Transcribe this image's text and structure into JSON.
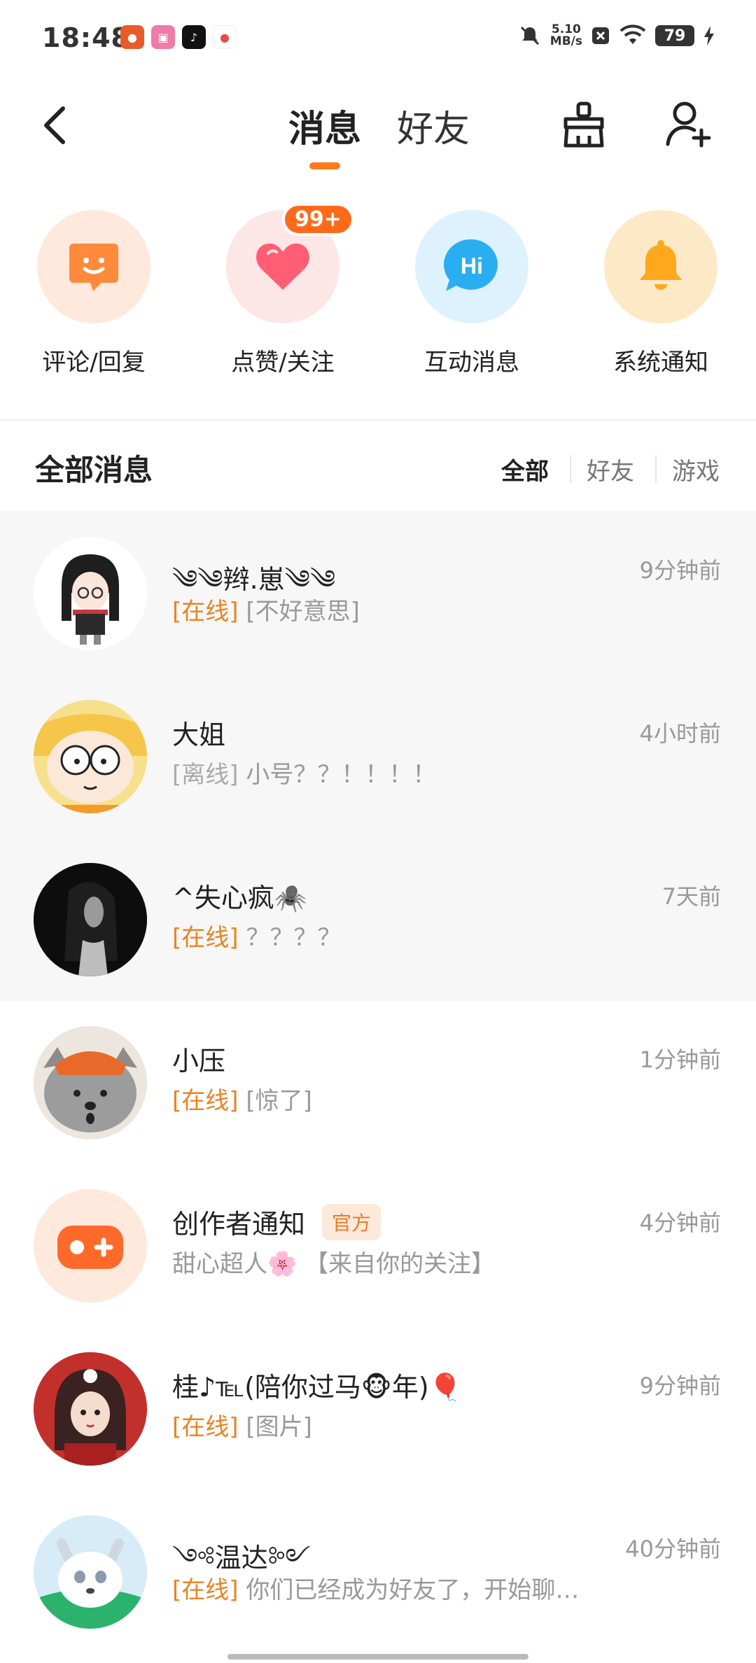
{
  "status_bar": {
    "time": "18:48",
    "speed_value": "5.10",
    "speed_unit": "MB/s",
    "battery": "79",
    "app_icons": [
      "food-app-icon",
      "bilibili-icon",
      "tiktok-icon",
      "map-pin-icon"
    ]
  },
  "header": {
    "tabs": [
      {
        "label": "消息",
        "active": true
      },
      {
        "label": "好友",
        "active": false
      }
    ],
    "accent_color": "#ff7a1a"
  },
  "shortcuts": [
    {
      "label": "评论/回复",
      "icon": "comment-bubble-icon",
      "bg": "#fee9dc",
      "fg": "#ff8a3c"
    },
    {
      "label": "点赞/关注",
      "icon": "heart-icon",
      "bg": "#fde6e6",
      "fg": "#ff5e74",
      "badge": "99+"
    },
    {
      "label": "互动消息",
      "icon": "hi-bubble-icon",
      "bg": "#ddf2fd",
      "fg": "#2aaef2",
      "icon_text": "Hi"
    },
    {
      "label": "系统通知",
      "icon": "bell-icon",
      "bg": "#fde9c6",
      "fg": "#ffa81c"
    }
  ],
  "section": {
    "title": "全部消息",
    "filters": [
      {
        "label": "全部",
        "active": true
      },
      {
        "label": "好友",
        "active": false
      },
      {
        "label": "游戏",
        "active": false
      }
    ]
  },
  "messages": [
    {
      "name": "༄༄辫.崽༄༄",
      "time": "9分钟前",
      "status": "[在线]",
      "online": true,
      "preview": " [不好意思]",
      "avatar": "anime-girl-avatar",
      "pinned": true
    },
    {
      "name": "大姐",
      "time": "4小时前",
      "status": "[离线]",
      "online": false,
      "preview": " 小号？？！！！！",
      "avatar": "cartoon-boy-avatar",
      "pinned": true
    },
    {
      "name": "^失心疯🕷️",
      "time": "7天前",
      "status": "[在线]",
      "online": true,
      "preview": " ？？？？",
      "avatar": "dark-portrait-avatar",
      "pinned": true
    },
    {
      "name": "小压",
      "time": "1分钟前",
      "status": "[在线]",
      "online": true,
      "preview": " [惊了]",
      "avatar": "grey-wolf-avatar",
      "pinned": false
    },
    {
      "name": "创作者通知",
      "official": "官方",
      "time": "4分钟前",
      "status": "",
      "online": false,
      "preview": "甜心超人🌸 【来自你的关注】",
      "avatar": "gamepad-avatar",
      "pinned": false
    },
    {
      "name": "桂♪℡(陪你过马🐵年)🎈",
      "time": "9分钟前",
      "status": "[在线]",
      "online": true,
      "preview": " [图片]",
      "avatar": "red-dress-girl-avatar",
      "pinned": false
    },
    {
      "name": "༺温达༻",
      "time": "40分钟前",
      "status": "[在线]",
      "online": true,
      "preview": " 你们已经成为好友了，开始聊…",
      "avatar": "white-fox-avatar",
      "pinned": false
    }
  ]
}
